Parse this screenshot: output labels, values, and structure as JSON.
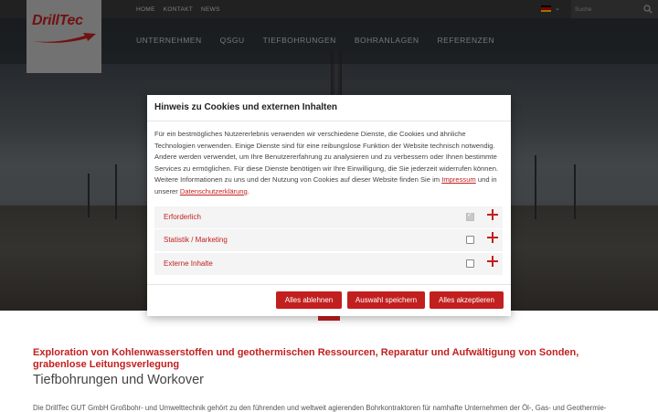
{
  "topbar": {
    "links": [
      "HOME",
      "KONTAKT",
      "NEWS"
    ],
    "search_placeholder": "Suche",
    "language_flag_colors": [
      "#000000",
      "#dd0000",
      "#ffce00"
    ]
  },
  "header": {
    "logo_text": "DrillTec",
    "nav": [
      "UNTERNEHMEN",
      "QSGU",
      "TIEFBOHRUNGEN",
      "BOHRANLAGEN",
      "REFERENZEN"
    ]
  },
  "modal": {
    "title": "Hinweis zu Cookies und externen Inhalten",
    "body_text": "Für ein bestmögliches Nutzererlebnis verwenden wir verschiedene Dienste, die Cookies und ähnliche Technologien verwenden. Einige Dienste sind für eine reibungslose Funktion der Website technisch notwendig. Andere werden verwendet, um Ihre Benutzererfahrung zu analysieren und zu verbessern oder Ihnen bestimmte Services zu ermöglichen. Für diese Dienste benötigen wir Ihre Einwilligung, die Sie jederzeit widerrufen können. Weitere Informationen zu uns und der Nutzung von Cookies auf dieser Website finden Sie im",
    "link_impressum": "Impressum",
    "link_joiner": "und in unserer",
    "link_datenschutz": "Datenschutzerklärung",
    "body_end": ".",
    "categories": [
      {
        "label": "Erforderlich",
        "checked": true,
        "disabled": true
      },
      {
        "label": "Statistik / Marketing",
        "checked": false,
        "disabled": false
      },
      {
        "label": "Externe Inhalte",
        "checked": false,
        "disabled": false
      }
    ],
    "buttons": {
      "reject": "Alles ablehnen",
      "save": "Auswahl speichern",
      "accept": "Alles akzeptieren"
    }
  },
  "content": {
    "headline": "Exploration von Kohlenwasserstoffen und geothermischen Ressourcen, Reparatur und Aufwältigung von Sonden, grabenlose Leitungsverlegung",
    "subhead": "Tiefbohrungen und Workover",
    "intro": "Die DrillTec GUT GmbH Großbohr- und Umwelttechnik gehört zu den führenden und weltweit agierenden Bohrkontraktoren für namhafte Unternehmen der Öl-, Gas- und Geothermie-"
  },
  "colors": {
    "brand_red": "#c21f1f",
    "topbar": "#3a3a3a",
    "logo_box": "#c4c4c4"
  }
}
